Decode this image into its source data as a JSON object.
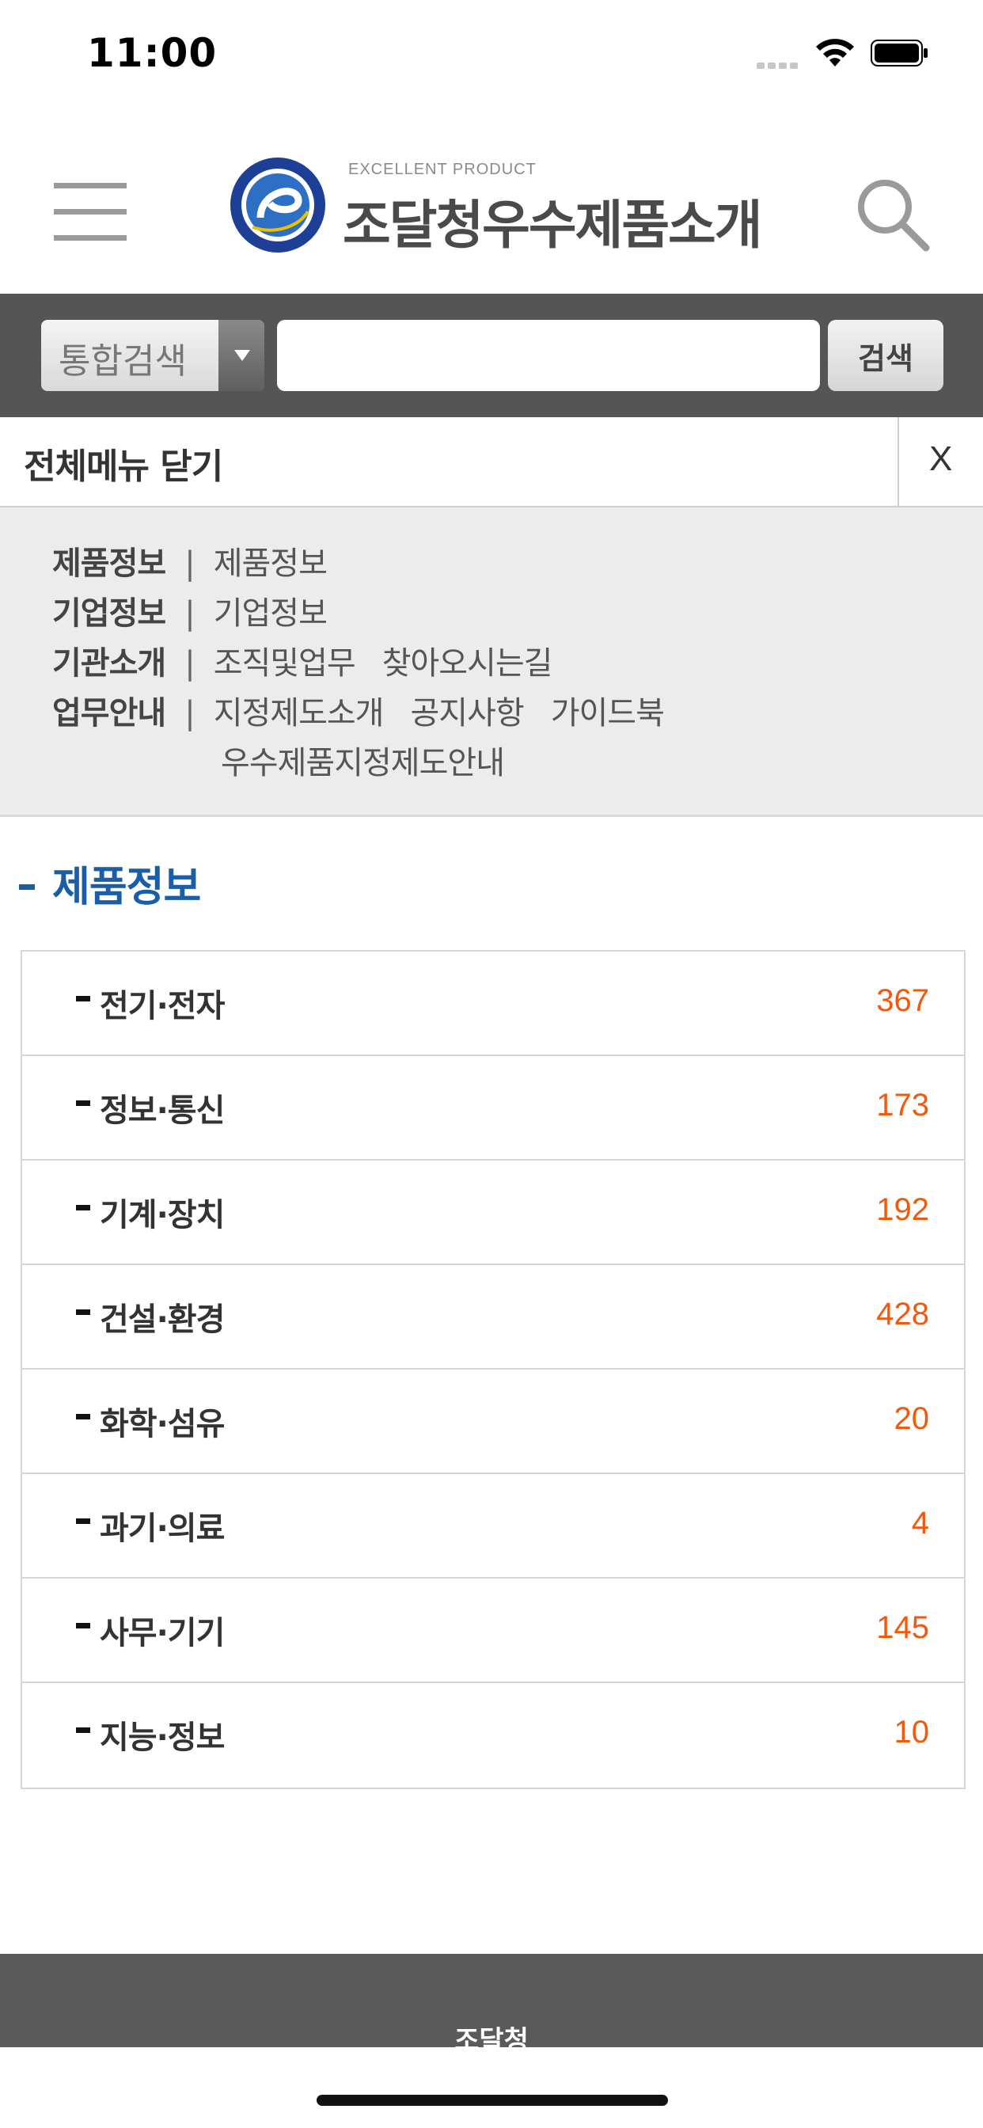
{
  "status_bar": {
    "time": "11:00"
  },
  "header": {
    "logo_subtitle": "EXCELLENT PRODUCT",
    "logo_title": "조달청우수제품소개"
  },
  "search": {
    "scope_label": "통합검색",
    "input_value": "",
    "button_label": "검색"
  },
  "menu": {
    "close_label": "전체메뉴 닫기",
    "close_x": "X"
  },
  "sitemap": {
    "separator": "|",
    "rows": [
      {
        "heading": "제품정보",
        "links": [
          "제품정보"
        ]
      },
      {
        "heading": "기업정보",
        "links": [
          "기업정보"
        ]
      },
      {
        "heading": "기관소개",
        "links": [
          "조직및업무",
          "찾아오시는길"
        ]
      },
      {
        "heading": "업무안내",
        "links": [
          "지정제도소개",
          "공지사항",
          "가이드북",
          "우수제품지정제도안내"
        ]
      }
    ]
  },
  "section": {
    "title": "제품정보",
    "categories": [
      {
        "name": "전기·전자",
        "count": "367"
      },
      {
        "name": "정보·통신",
        "count": "173"
      },
      {
        "name": "기계·장치",
        "count": "192"
      },
      {
        "name": "건설·환경",
        "count": "428"
      },
      {
        "name": "화학·섬유",
        "count": "20"
      },
      {
        "name": "과기·의료",
        "count": "4"
      },
      {
        "name": "사무·기기",
        "count": "145"
      },
      {
        "name": "지능·정보",
        "count": "10"
      }
    ]
  },
  "footer": {
    "label": "조달청"
  },
  "colors": {
    "accent_blue": "#1a5ea8",
    "count_orange": "#f15a0d",
    "search_bar_bg": "#555555",
    "footer_bg": "#5a5a5a"
  },
  "icons": [
    "signal-icon",
    "wifi-icon",
    "battery-icon",
    "hamburger-icon",
    "logo-emblem-icon",
    "search-icon",
    "dropdown-arrow-icon"
  ]
}
